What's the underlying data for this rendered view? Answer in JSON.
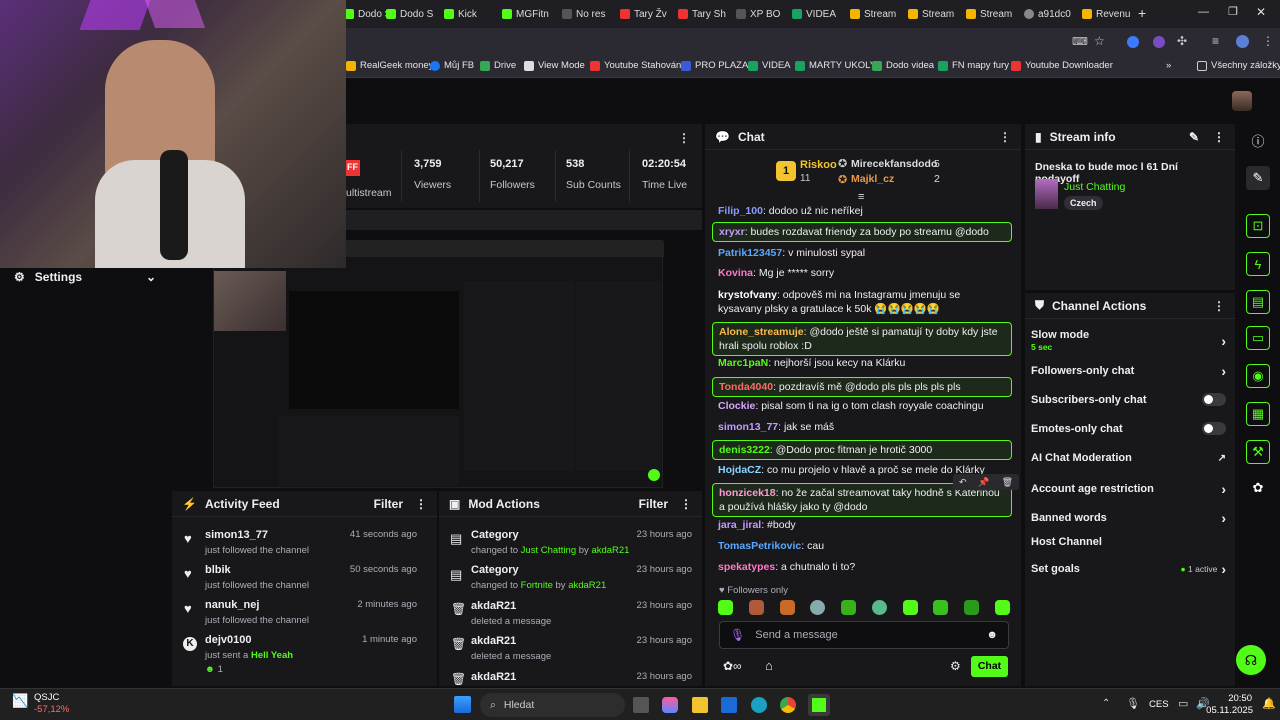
{
  "tabs": [
    "Dodo S",
    "Dodo S",
    "Kick",
    "MGFitn",
    "No res",
    "Tary Žv",
    "Tary Sh",
    "XP BO",
    "VIDEA",
    "Stream",
    "Stream",
    "Stream",
    "a91dc0",
    "Revenu"
  ],
  "bookmarks": [
    "RealGeek money",
    "Můj FB",
    "Drive",
    "View Mode",
    "Youtube Stahování",
    "PRO PLAZA",
    "VIDEA",
    "MARTY UKOLY",
    "Dodo videa",
    "FN mapy fury",
    "Youtube Downloader",
    "Všechny záložky"
  ],
  "stats": {
    "multistream_label": "ultistream",
    "viewers": "3,759",
    "viewers_label": "Viewers",
    "followers": "50,217",
    "followers_label": "Followers",
    "subs": "538",
    "subs_label": "Sub Counts",
    "time": "02:20:54",
    "time_label": "Time Live",
    "off_badge": "FF"
  },
  "settings_label": "Settings",
  "activity": {
    "title": "Activity Feed",
    "filter": "Filter",
    "items": [
      {
        "name": "simon13_77",
        "sub": "just followed the channel",
        "time": "41 seconds ago"
      },
      {
        "name": "blbik",
        "sub": "just followed the channel",
        "time": "50 seconds ago"
      },
      {
        "name": "nanuk_nej",
        "sub": "just followed the channel",
        "time": "2 minutes ago"
      },
      {
        "name": "dejv0100",
        "sub": "just sent a",
        "sub_green": "Hell Yeah",
        "count": "1",
        "time": "1 minute ago"
      }
    ]
  },
  "mod": {
    "title": "Mod Actions",
    "filter": "Filter",
    "items": [
      {
        "name": "Category",
        "sub1": "changed to",
        "g1": "Just Chatting",
        "sub2": "by",
        "g2": "akdaR21",
        "time": "23 hours ago"
      },
      {
        "name": "Category",
        "sub1": "changed to",
        "g1": "Fortnite",
        "sub2": "by",
        "g2": "akdaR21",
        "time": "23 hours ago"
      },
      {
        "name": "akdaR21",
        "sub1": "deleted a message",
        "time": "23 hours ago"
      },
      {
        "name": "akdaR21",
        "sub1": "deleted a message",
        "time": "23 hours ago"
      },
      {
        "name": "akdaR21",
        "time": "23 hours ago"
      }
    ]
  },
  "chat": {
    "title": "Chat",
    "top1_name": "Riskoo",
    "top1_rank": "1",
    "top1_count": "11",
    "top2_name": "Mirecekfansdodo",
    "top2_count": "5",
    "top3_name": "Majkl_cz",
    "top3_count": "2",
    "messages": [
      {
        "user": "Filip_100",
        "color": "#8a9cff",
        "text": "dodoo už nic neříkej",
        "hl": false
      },
      {
        "user": "xryxr",
        "color": "#c49bff",
        "text": "budes rozdavat friendy za body po streamu @dodo",
        "hl": true
      },
      {
        "user": "Patrik123457",
        "color": "#5aa9ff",
        "text": "v minulosti sypal",
        "hl": false
      },
      {
        "user": "Kovina",
        "color": "#ff79c6",
        "text": "Mg je ***** sorry",
        "hl": false
      },
      {
        "user": "krystofvany",
        "color": "#ffffff",
        "text": "odpověš mi na Instagramu jmenuju se kysavany plsky a gratulace k 50k 😭😭😭😭😭",
        "hl": false
      },
      {
        "user": "Alone_streamuje",
        "color": "#ffb84d",
        "text": "@dodo ještě si pamatují ty doby kdy jste hrali spolu roblox :D",
        "hl": true
      },
      {
        "user": "Marc1paN",
        "color": "#53fc18",
        "text": "nejhorší jsou kecy na Klárku",
        "hl": false
      },
      {
        "user": "Tonda4040",
        "color": "#ff6b6b",
        "text": "pozdravíš mě @dodo pls pls pls pls pls",
        "hl": true
      },
      {
        "user": "Clockie",
        "color": "#d7a6ff",
        "text": "pisal som ti na ig o tom clash royyale coachingu",
        "hl": false
      },
      {
        "user": "simon13_77",
        "color": "#c49bff",
        "text": "jak se máš",
        "hl": false
      },
      {
        "user": "denis3222",
        "color": "#53fc18",
        "text": "@Dodo proc fitman je hrotič 3000",
        "hl": true
      },
      {
        "user": "HojdaCZ",
        "color": "#8ad6ff",
        "text": "co mu projelo v hlavě a proč se mele do Klárky",
        "hl": false
      },
      {
        "user": "honzicek18",
        "color": "#ff9ad5",
        "text": "no že začal streamovat taky hodně s Kateřinou a používá hlášky jako ty @dodo",
        "hl": true
      },
      {
        "user": "jara_jiral",
        "color": "#c49bff",
        "text": "#body",
        "hl": false
      },
      {
        "user": "TomasPetrikovic",
        "color": "#5aa9ff",
        "text": "cau",
        "hl": false
      },
      {
        "user": "spekatypes",
        "color": "#ff79c6",
        "text": "a chutnalo ti to?",
        "hl": false
      }
    ],
    "followers_only": "Followers only",
    "placeholder": "Send a message",
    "send": "Chat"
  },
  "stream_info": {
    "title": "Stream info",
    "stream_title": "Dneska to bude moc l 61 Dní nodayoff",
    "category": "Just Chatting",
    "language": "Czech"
  },
  "channel_actions": {
    "title": "Channel Actions",
    "slow_mode": "Slow mode",
    "slow_value": "5 sec",
    "followers_only": "Followers-only chat",
    "subscribers_only": "Subscribers-only chat",
    "emotes_only": "Emotes-only chat",
    "ai_moderation": "AI Chat Moderation",
    "account_age": "Account age restriction",
    "banned_words": "Banned words",
    "host": "Host Channel",
    "goals": "Set goals",
    "goals_status": "1 active"
  },
  "taskbar": {
    "stock_name": "QSJC",
    "stock_change": "-57,12%",
    "search": "Hledat",
    "lang": "CES",
    "time": "20:50",
    "date": "05.11.2025"
  },
  "colors": {
    "accent": "#53fc18",
    "panel": "#18181b",
    "bg": "#0e0e10"
  }
}
